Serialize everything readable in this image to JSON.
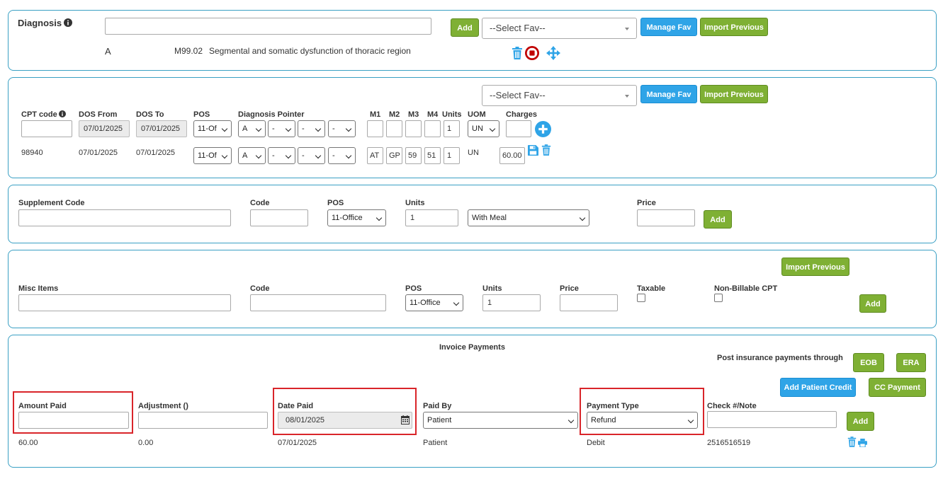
{
  "colors": {
    "panel_border": "#3aa0c4",
    "green_button": "#7fb034",
    "blue_button": "#2fa4e7",
    "highlight": "#d9252a",
    "icon_blue": "#2fa4e7",
    "stop_red": "#c00000"
  },
  "diagnosis": {
    "title": "Diagnosis",
    "search_value": "",
    "add_label": "Add",
    "fav_placeholder": "--Select Fav--",
    "manage_fav_label": "Manage Fav",
    "import_previous_label": "Import Previous",
    "row": {
      "pointer": "A",
      "code": "M99.02",
      "description": "Segmental and somatic dysfunction of thoracic region"
    }
  },
  "cpt": {
    "fav_placeholder": "--Select Fav--",
    "manage_fav_label": "Manage Fav",
    "import_previous_label": "Import Previous",
    "headers": {
      "cpt_code": "CPT code",
      "dos_from": "DOS From",
      "dos_to": "DOS To",
      "pos": "POS",
      "diagnosis_pointer": "Diagnosis Pointer",
      "m1": "M1",
      "m2": "M2",
      "m3": "M3",
      "m4": "M4",
      "units": "Units",
      "uom": "UOM",
      "charges": "Charges"
    },
    "entry": {
      "cpt_code": "",
      "dos_from": "07/01/2025",
      "dos_to": "07/01/2025",
      "pos": "11-Of",
      "ptr1": "A",
      "ptr2": "-",
      "ptr3": "-",
      "ptr4": "-",
      "m1": "",
      "m2": "",
      "m3": "",
      "m4": "",
      "units": "1",
      "uom": "UN",
      "charges": ""
    },
    "line": {
      "cpt_code": "98940",
      "dos_from": "07/01/2025",
      "dos_to": "07/01/2025",
      "pos": "11-Of",
      "ptr1": "A",
      "ptr2": "-",
      "ptr3": "-",
      "ptr4": "-",
      "m1": "AT",
      "m2": "GP",
      "m3": "59",
      "m4": "51",
      "units": "1",
      "uom": "UN",
      "charges": "60.00"
    }
  },
  "supplement": {
    "headers": {
      "supplement_code": "Supplement Code",
      "code": "Code",
      "pos": "POS",
      "units": "Units",
      "price": "Price"
    },
    "supplement_code": "",
    "code": "",
    "pos": "11-Office",
    "units": "1",
    "meal": "With Meal",
    "price": "",
    "add_label": "Add"
  },
  "misc": {
    "import_previous_label": "Import Previous",
    "headers": {
      "misc_items": "Misc Items",
      "code": "Code",
      "pos": "POS",
      "units": "Units",
      "price": "Price",
      "taxable": "Taxable",
      "non_billable": "Non-Billable CPT"
    },
    "misc_items": "",
    "code": "",
    "pos": "11-Office",
    "units": "1",
    "price": "",
    "add_label": "Add"
  },
  "payments": {
    "title": "Invoice Payments",
    "post_through_label": "Post insurance payments through",
    "eob_label": "EOB",
    "era_label": "ERA",
    "add_patient_credit_label": "Add Patient Credit",
    "cc_payment_label": "CC Payment",
    "headers": {
      "amount_paid": "Amount Paid",
      "adjustment": "Adjustment ()",
      "date_paid": "Date Paid",
      "paid_by": "Paid By",
      "payment_type": "Payment Type",
      "check_note": "Check #/Note"
    },
    "entry": {
      "amount_paid": "",
      "adjustment": "",
      "date_paid": "08/01/2025",
      "paid_by": "Patient",
      "payment_type": "Refund",
      "check_note": ""
    },
    "add_label": "Add",
    "row": {
      "amount_paid": "60.00",
      "adjustment": "0.00",
      "date_paid": "07/01/2025",
      "paid_by": "Patient",
      "payment_type": "Debit",
      "check_note": "2516516519"
    }
  }
}
